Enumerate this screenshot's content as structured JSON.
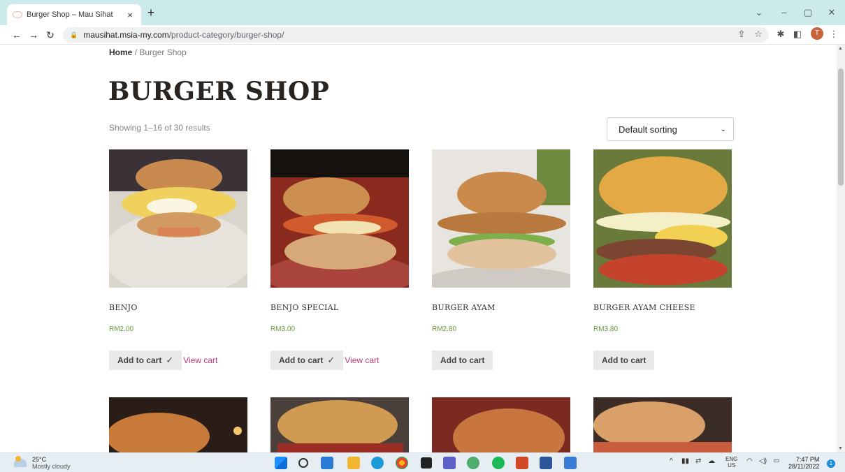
{
  "browser": {
    "tab_title": "Burger Shop – Mau Sihat",
    "tab_close": "×",
    "new_tab": "+",
    "url_host": "mausihat.msia-my.com",
    "url_path": "/product-category/burger-shop/",
    "avatar_letter": "T"
  },
  "breadcrumb": {
    "home": "Home",
    "separator": " / ",
    "current": "Burger Shop"
  },
  "page_title": "BURGER SHOP",
  "result_count": "Showing 1–16 of 30 results",
  "sorting": {
    "selected": "Default sorting"
  },
  "products": [
    {
      "name": "BENJO",
      "price": "RM2.00",
      "cart_label": "Add to cart",
      "added": true,
      "view_cart": "View cart"
    },
    {
      "name": "BENJO SPECIAL",
      "price": "RM3.00",
      "cart_label": "Add to cart",
      "added": true,
      "view_cart": "View cart"
    },
    {
      "name": "BURGER AYAM",
      "price": "RM2.80",
      "cart_label": "Add to cart",
      "added": false
    },
    {
      "name": "BURGER AYAM CHEESE",
      "price": "RM3.80",
      "cart_label": "Add to cart",
      "added": false
    }
  ],
  "taskbar": {
    "temperature": "25°C",
    "condition": "Mostly cloudy",
    "lang_top": "ENG",
    "lang_bottom": "US",
    "time": "7:47 PM",
    "date": "28/11/2022",
    "notifications": "1"
  }
}
